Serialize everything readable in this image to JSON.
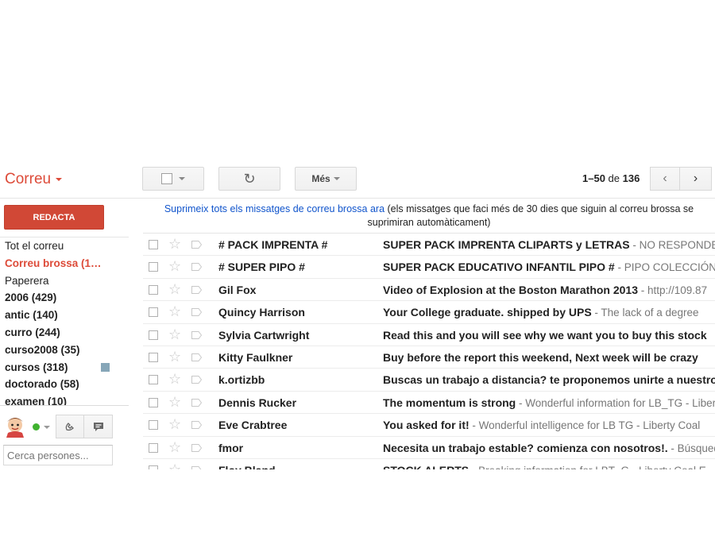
{
  "header": {
    "title": "Correu",
    "more_label": "Més",
    "refresh_glyph": "↻",
    "pager": {
      "start_end": "1–50",
      "of": "de",
      "total": "136"
    },
    "older_glyph": "‹",
    "newer_glyph": "›"
  },
  "compose_label": "REDACTA",
  "sidebar": {
    "items": [
      {
        "label": "Tot el correu",
        "style": "normal"
      },
      {
        "label": "Correu brossa (1…",
        "style": "active"
      },
      {
        "label": "Paperera",
        "style": "normal"
      },
      {
        "label": "2006 (429)",
        "style": "bold"
      },
      {
        "label": "antic (140)",
        "style": "bold"
      },
      {
        "label": "curro (244)",
        "style": "bold"
      },
      {
        "label": "curso2008 (35)",
        "style": "bold"
      },
      {
        "label": "cursos (318)",
        "style": "bold",
        "swatch": "#86a6b8"
      },
      {
        "label": "doctorado (58)",
        "style": "bold"
      },
      {
        "label": "examen (10)",
        "style": "bold"
      }
    ]
  },
  "chat": {
    "search_placeholder": "Cerca persones...",
    "presence_color": "#3fb22f"
  },
  "notice": {
    "link": "Suprimeix tots els missatges de correu brossa ara",
    "text": " (els missatges que faci més de 30 dies que siguin al correu brossa se suprimiran automàticament)"
  },
  "emails": [
    {
      "sender": "# PACK IMPRENTA #",
      "subject": "SUPER PACK IMPRENTA CLIPARTS y LETRAS",
      "snippet": " - NO RESPONDER"
    },
    {
      "sender": "# SUPER PIPO #",
      "subject": "SUPER PACK EDUCATIVO INFANTIL PIPO #",
      "snippet": " - PIPO COLECCIÓN"
    },
    {
      "sender": "Gil Fox",
      "subject": "Video of Explosion at the Boston Marathon 2013",
      "snippet": " - http://109.87"
    },
    {
      "sender": "Quincy Harrison",
      "subject": "Your College graduate. shipped by UPS",
      "snippet": " - The lack of a degree"
    },
    {
      "sender": "Sylvia Cartwright",
      "subject": "Read this and you will see why we want you to buy this stock",
      "snippet": ""
    },
    {
      "sender": "Kitty Faulkner",
      "subject": "Buy before the report this weekend, Next week will be crazy",
      "snippet": ""
    },
    {
      "sender": "k.ortizbb",
      "subject": "Buscas un trabajo a distancia? te proponemos unirte a nuestro",
      "snippet": ""
    },
    {
      "sender": "Dennis Rucker",
      "subject": "The momentum is strong",
      "snippet": " - Wonderful information for LB_TG - Liberty"
    },
    {
      "sender": "Eve Crabtree",
      "subject": "You asked for it!",
      "snippet": " - Wonderful intelligence for LB TG - Liberty Coal"
    },
    {
      "sender": "fmor",
      "subject": "Necesita un trabajo estable? comienza con nosotros!.",
      "snippet": " - Búsqueda"
    },
    {
      "sender": "Floy Bland",
      "subject": "STOCK ALERTS",
      "snippet": " - Breaking information for LBT_G - Liberty Coal E"
    }
  ],
  "colors": {
    "accent": "#dd4b39",
    "compose": "#d14836",
    "link": "#1155cc"
  }
}
